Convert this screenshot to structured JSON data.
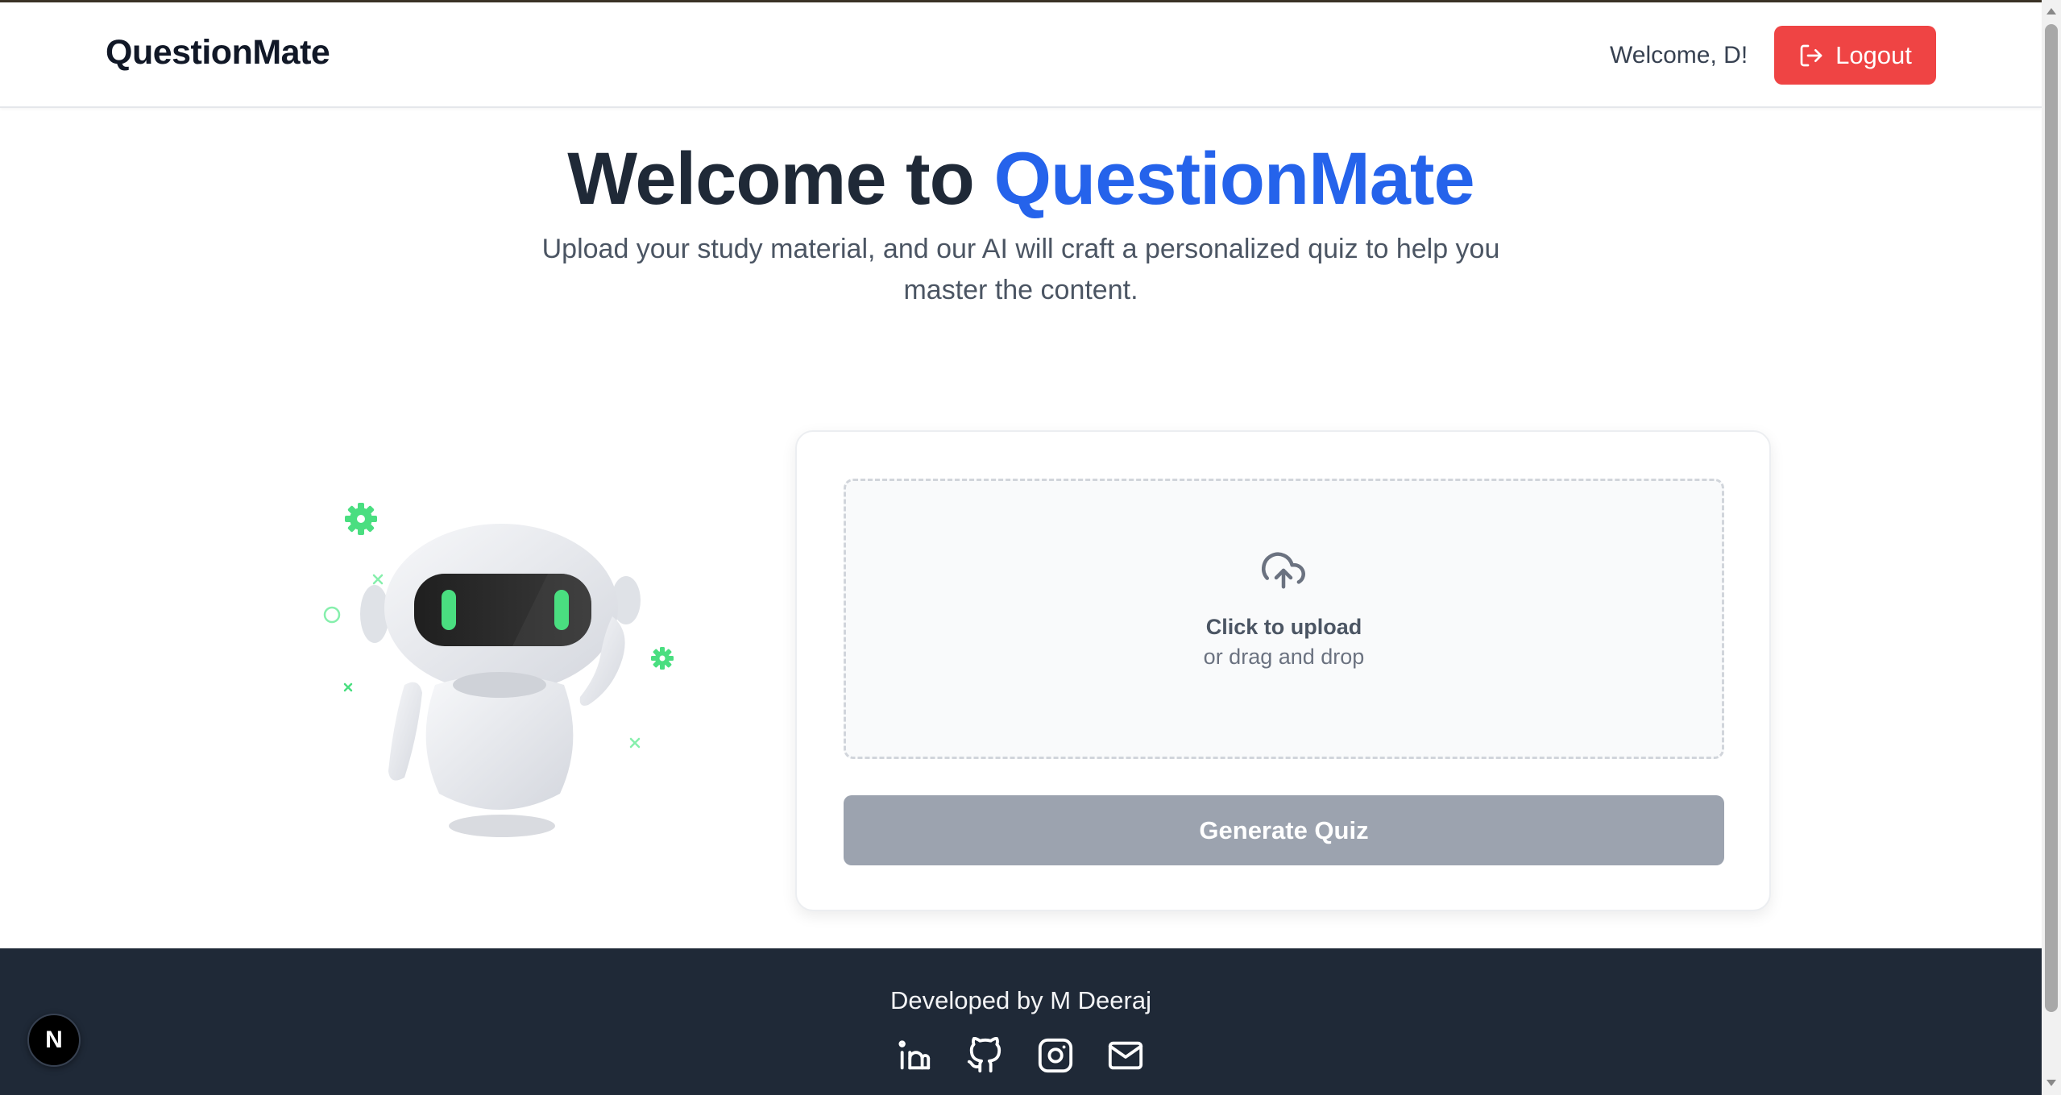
{
  "navbar": {
    "brand": "QuestionMate",
    "welcome_text": "Welcome, D!",
    "logout_label": "Logout",
    "logout_color": "#ef4444"
  },
  "hero": {
    "title_prefix": "Welcome to ",
    "title_accent": "QuestionMate",
    "accent_color": "#2563eb",
    "subtitle": "Upload your study material, and our AI will craft a personalized quiz to help you master the content."
  },
  "upload": {
    "icon": "cloud-upload-icon",
    "title": "Click to upload",
    "subtitle": "or drag and drop",
    "generate_label": "Generate Quiz",
    "generate_state": "disabled"
  },
  "footer": {
    "credit": "Developed by M Deeraj",
    "socials": [
      {
        "name": "linkedin",
        "icon": "linkedin-icon"
      },
      {
        "name": "github",
        "icon": "github-icon"
      },
      {
        "name": "instagram",
        "icon": "instagram-icon"
      },
      {
        "name": "email",
        "icon": "mail-icon"
      }
    ]
  },
  "dev_badge": {
    "letter": "N"
  }
}
